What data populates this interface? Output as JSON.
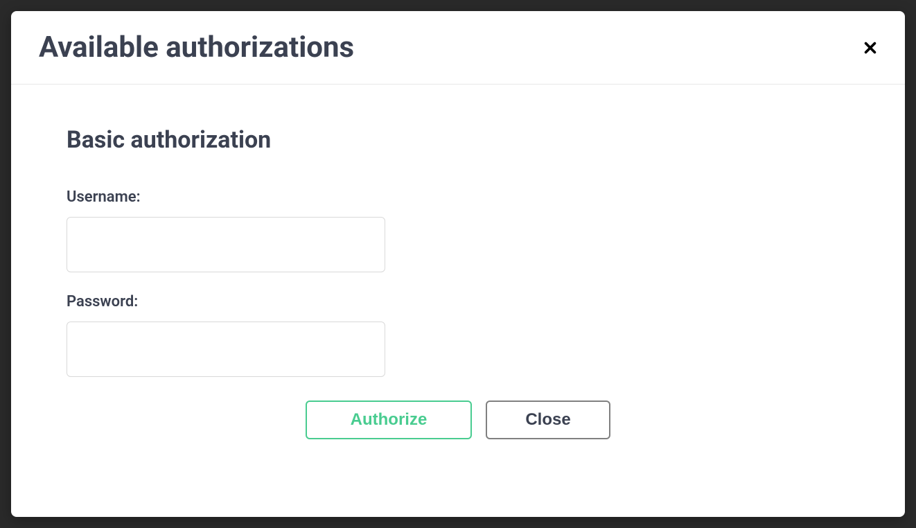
{
  "modal": {
    "title": "Available authorizations"
  },
  "section": {
    "title": "Basic authorization"
  },
  "form": {
    "username_label": "Username:",
    "username_value": "",
    "password_label": "Password:",
    "password_value": ""
  },
  "buttons": {
    "authorize": "Authorize",
    "close": "Close"
  }
}
